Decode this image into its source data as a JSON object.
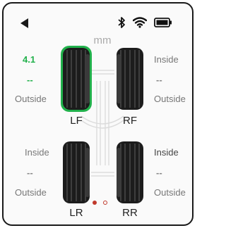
{
  "unit": "mm",
  "tires": {
    "lf": {
      "name": "LF",
      "value": "4.1",
      "middle": "--",
      "side": "Outside"
    },
    "rf": {
      "name": "RF",
      "value": "Inside",
      "middle": "--",
      "side": "Outside"
    },
    "lr": {
      "name": "LR",
      "value": "Inside",
      "middle": "--",
      "side": "Outside"
    },
    "rr": {
      "name": "RR",
      "value": "Inside",
      "middle": "--",
      "side": "Outside"
    }
  },
  "status": {
    "icons": [
      "bluetooth-icon",
      "wifi-icon",
      "battery-icon"
    ]
  },
  "pager": {
    "count": 2,
    "active": 0
  },
  "colors": {
    "accent": "#22b14c",
    "pager": "#c0392b",
    "tire": "#1c1c1c"
  }
}
